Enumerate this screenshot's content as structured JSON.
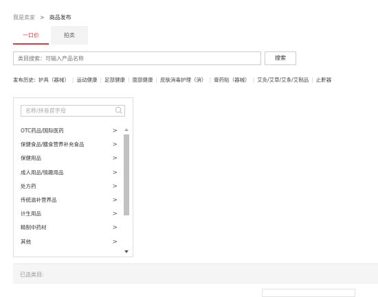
{
  "breadcrumb": {
    "parent": "我是卖家",
    "separator": ">",
    "current": "商品发布"
  },
  "tabs": [
    {
      "label": "一口价",
      "active": true
    },
    {
      "label": "拍卖",
      "active": false
    }
  ],
  "search": {
    "placeholder": "类目搜索：可输入产品名称",
    "button_label": "搜索"
  },
  "history": {
    "label": "发布历史:",
    "items": [
      "护具（器械）",
      "运动健康",
      "足部健康",
      "面部健康",
      "皮肤消毒护理（消）",
      "膏药贴（器械）",
      "艾灸/艾草/艾条/艾制品",
      "止鼾器"
    ]
  },
  "category_panel": {
    "search_placeholder": "名称/拼音首字母",
    "items": [
      "OTC药品/国际医药",
      "保健食品/膳食营养补充食品",
      "保健用品",
      "成人用品/情趣用品",
      "处方药",
      "传统滋补营养品",
      "计生用品",
      "精制中药材",
      "其他"
    ]
  },
  "selected": {
    "label": "已选类目:"
  },
  "colors": {
    "accent": "#e4393c",
    "border": "#cccccc",
    "muted": "#999999"
  }
}
